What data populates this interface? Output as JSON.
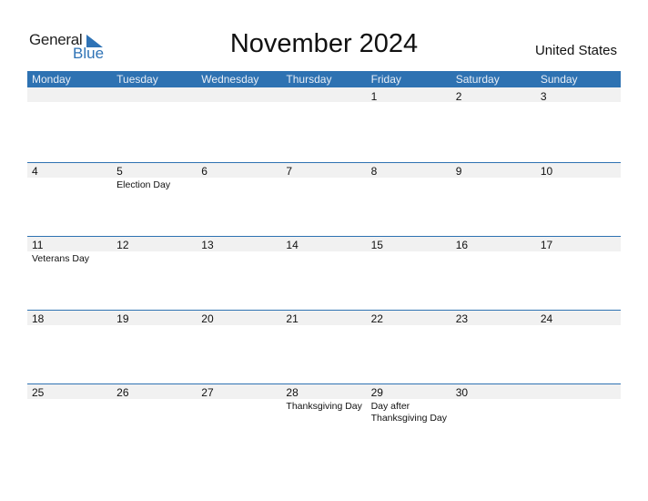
{
  "logo": {
    "general": "General",
    "blue": "Blue"
  },
  "title": "November 2024",
  "country": "United States",
  "colors": {
    "accent": "#2e72b2",
    "band": "#f1f1f1"
  },
  "weekdays": [
    "Monday",
    "Tuesday",
    "Wednesday",
    "Thursday",
    "Friday",
    "Saturday",
    "Sunday"
  ],
  "weeks": [
    {
      "days": [
        {
          "n": "",
          "h": ""
        },
        {
          "n": "",
          "h": ""
        },
        {
          "n": "",
          "h": ""
        },
        {
          "n": "",
          "h": ""
        },
        {
          "n": "1",
          "h": ""
        },
        {
          "n": "2",
          "h": ""
        },
        {
          "n": "3",
          "h": ""
        }
      ]
    },
    {
      "days": [
        {
          "n": "4",
          "h": ""
        },
        {
          "n": "5",
          "h": "Election Day"
        },
        {
          "n": "6",
          "h": ""
        },
        {
          "n": "7",
          "h": ""
        },
        {
          "n": "8",
          "h": ""
        },
        {
          "n": "9",
          "h": ""
        },
        {
          "n": "10",
          "h": ""
        }
      ]
    },
    {
      "days": [
        {
          "n": "11",
          "h": "Veterans Day"
        },
        {
          "n": "12",
          "h": ""
        },
        {
          "n": "13",
          "h": ""
        },
        {
          "n": "14",
          "h": ""
        },
        {
          "n": "15",
          "h": ""
        },
        {
          "n": "16",
          "h": ""
        },
        {
          "n": "17",
          "h": ""
        }
      ]
    },
    {
      "days": [
        {
          "n": "18",
          "h": ""
        },
        {
          "n": "19",
          "h": ""
        },
        {
          "n": "20",
          "h": ""
        },
        {
          "n": "21",
          "h": ""
        },
        {
          "n": "22",
          "h": ""
        },
        {
          "n": "23",
          "h": ""
        },
        {
          "n": "24",
          "h": ""
        }
      ]
    },
    {
      "days": [
        {
          "n": "25",
          "h": ""
        },
        {
          "n": "26",
          "h": ""
        },
        {
          "n": "27",
          "h": ""
        },
        {
          "n": "28",
          "h": "Thanksgiving Day"
        },
        {
          "n": "29",
          "h": "Day after Thanksgiving Day"
        },
        {
          "n": "30",
          "h": ""
        },
        {
          "n": "",
          "h": ""
        }
      ]
    }
  ]
}
